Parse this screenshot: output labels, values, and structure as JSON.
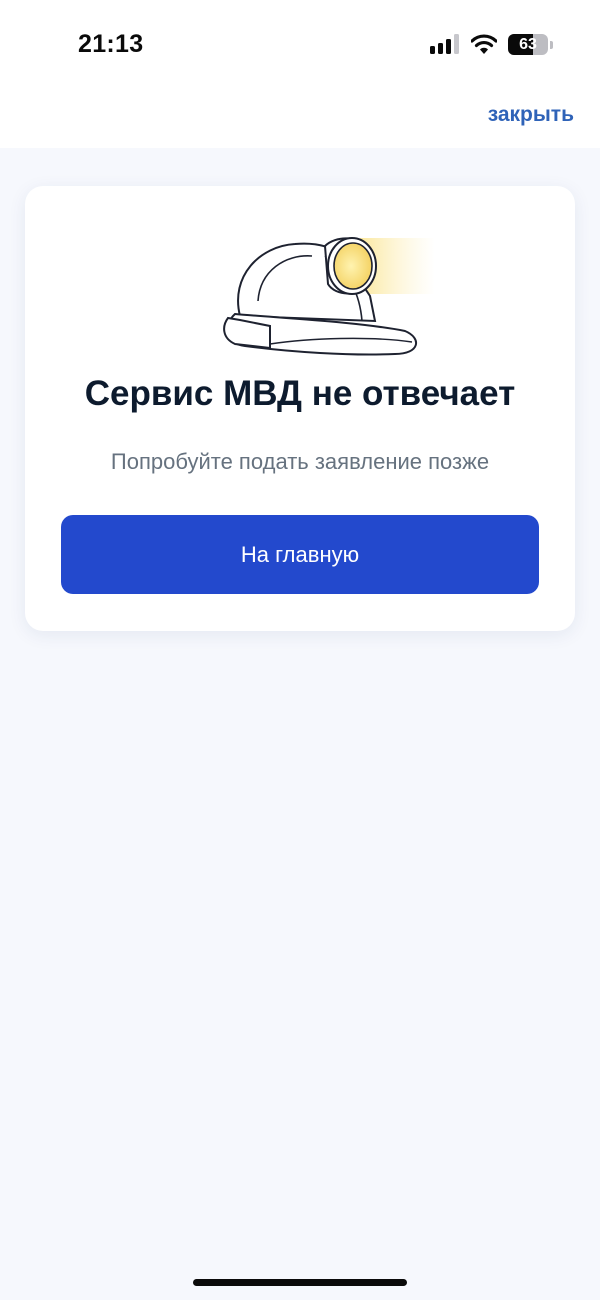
{
  "status_bar": {
    "time": "21:13",
    "battery_level": "63",
    "signal_icon": "cellular-signal-icon",
    "wifi_icon": "wifi-icon",
    "battery_icon": "battery-icon"
  },
  "header": {
    "close_label": "закрыть"
  },
  "card": {
    "illustration_icon": "miner-helmet-icon",
    "title": "Сервис МВД не отвечает",
    "subtitle": "Попробуйте подать заявление позже",
    "button_label": "На главную"
  },
  "colors": {
    "accent": "#2349cd",
    "link": "#2f63b8",
    "background": "#f6f8fd",
    "title": "#0d1b2e",
    "subtitle": "#66727f"
  }
}
